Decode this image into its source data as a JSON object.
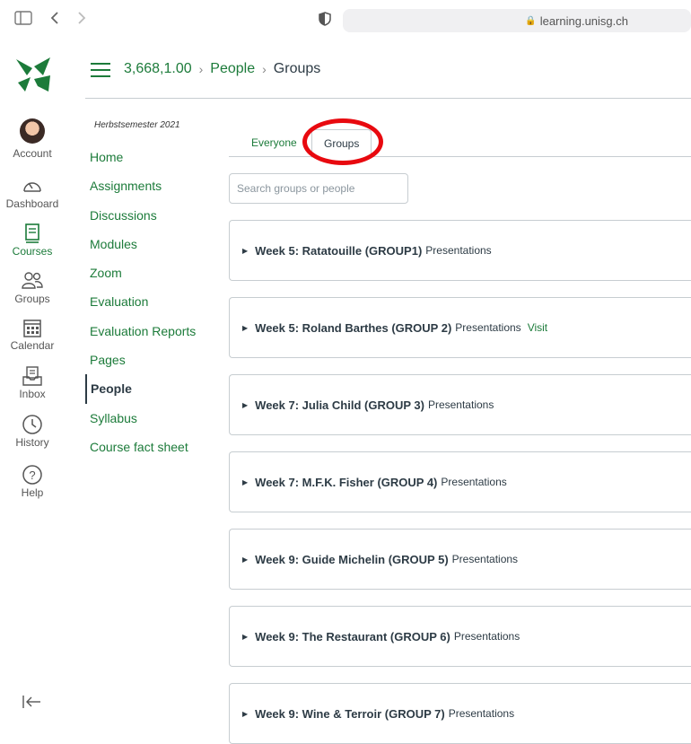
{
  "browser": {
    "url": "learning.unisg.ch"
  },
  "global_nav": {
    "items": [
      {
        "label": "Account",
        "icon": "avatar"
      },
      {
        "label": "Dashboard",
        "icon": "dashboard-icon"
      },
      {
        "label": "Courses",
        "icon": "courses-icon"
      },
      {
        "label": "Groups",
        "icon": "groups-icon"
      },
      {
        "label": "Calendar",
        "icon": "calendar-icon"
      },
      {
        "label": "Inbox",
        "icon": "inbox-icon"
      },
      {
        "label": "History",
        "icon": "history-icon"
      },
      {
        "label": "Help",
        "icon": "help-icon"
      }
    ],
    "accent": "#1c7b3a"
  },
  "breadcrumb": {
    "course": "3,668,1.00",
    "section": "People",
    "current": "Groups"
  },
  "course_nav": {
    "term": "Herbstsemester 2021",
    "items": [
      "Home",
      "Assignments",
      "Discussions",
      "Modules",
      "Zoom",
      "Evaluation",
      "Evaluation Reports",
      "Pages",
      "People",
      "Syllabus",
      "Course fact sheet"
    ],
    "active": "People"
  },
  "tabs": {
    "everyone": "Everyone",
    "groups": "Groups"
  },
  "search": {
    "placeholder": "Search groups or people"
  },
  "groups": [
    {
      "name": "Week 5: Ratatouille (GROUP1)",
      "category": "Presentations",
      "visit": ""
    },
    {
      "name": "Week 5: Roland Barthes (GROUP 2)",
      "category": "Presentations",
      "visit": "Visit"
    },
    {
      "name": "Week 7: Julia Child (GROUP 3)",
      "category": "Presentations",
      "visit": ""
    },
    {
      "name": "Week 7: M.F.K. Fisher (GROUP 4)",
      "category": "Presentations",
      "visit": ""
    },
    {
      "name": "Week 9: Guide Michelin (GROUP 5)",
      "category": "Presentations",
      "visit": ""
    },
    {
      "name": "Week 9: The Restaurant (GROUP 6)",
      "category": "Presentations",
      "visit": ""
    },
    {
      "name": "Week 9: Wine & Terroir (GROUP 7)",
      "category": "Presentations",
      "visit": ""
    }
  ]
}
